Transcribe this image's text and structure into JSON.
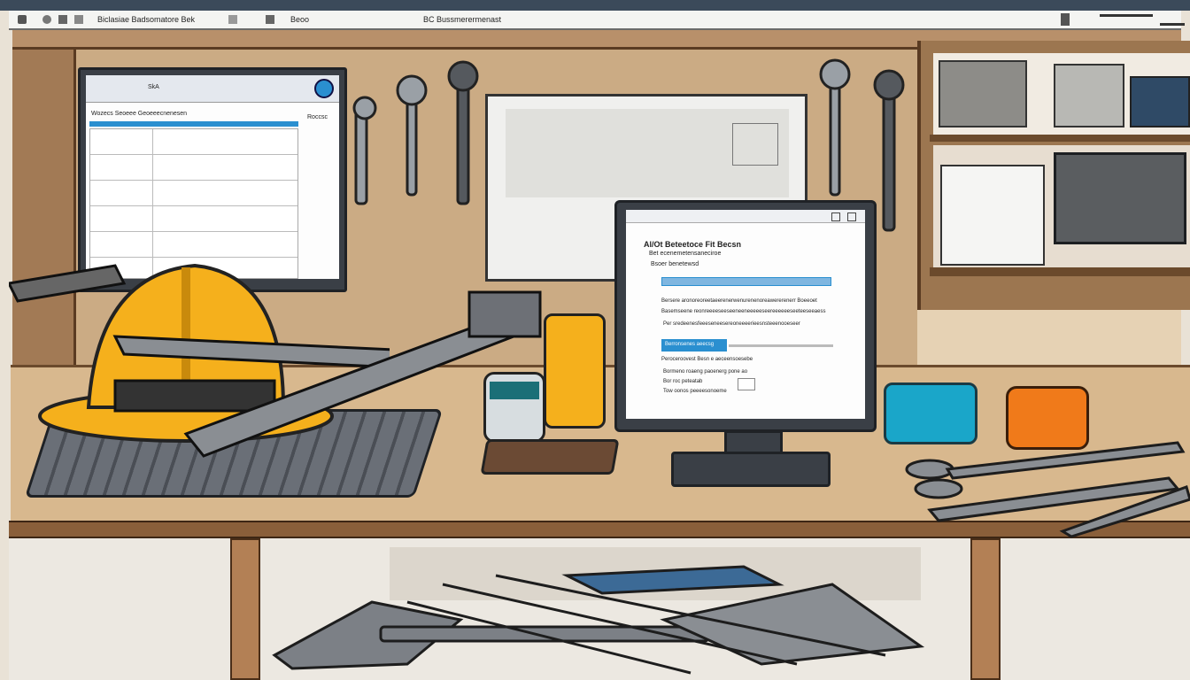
{
  "browser_bar": {
    "tab_text": "Biclasiae Badsomatore Bek",
    "tab_short": "Beoo",
    "address_text": "BC Bussmerermenast"
  },
  "left_monitor": {
    "toolbar_text": "SkA",
    "header_text": "Wozecs Seoeee Geoeeecnenesen",
    "side_label": "Roccsc"
  },
  "center_monitor": {
    "title": "Al/Ot Beteetoce Fit Becsn",
    "subtitle": "Bet ecenemetensaneciroe",
    "field_label": "Bsoer benetewsd",
    "body_line_1": "Bersere aronoreoreetaeerenerwenurenenoreawererenerr Boeeoet",
    "body_line_2": "Basemseene reonreeeeseeseeneeneeeeeseereeeeeeseeteeseeaess",
    "body_line_3": "Per sredeenesfeeeseneesereoneeeerieesnsteeenooeseer",
    "button_label": "Berronsenes aeecsg",
    "section_label": "Peroceroovest Besn e aeceensoesebe",
    "row1_label": "Bormeno roaeng paoenerg pone ao",
    "row2_label": "Bor roc peteatab",
    "row3_label": "Tow oonos peeeesonoeme"
  },
  "colors": {
    "helmet": "#f5b01c",
    "accent_blue": "#2a8fd0",
    "teal_case": "#1aa6c9",
    "orange_case": "#f07a1a",
    "desk": "#d8b88e",
    "wood_dark": "#5a3b22"
  }
}
